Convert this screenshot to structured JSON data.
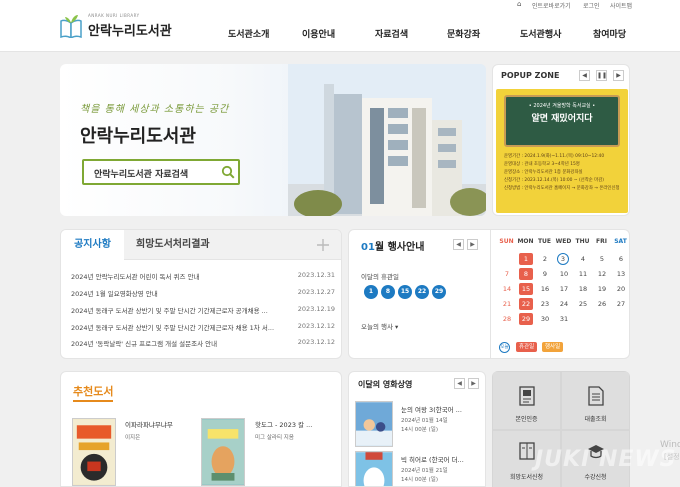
{
  "header": {
    "logo_sub": "ANRAK NURI LIBRARY",
    "logo_text": "안락누리도서관",
    "util": {
      "home": "⌂",
      "login_info": "인트로바로가기",
      "login": "로그인",
      "sitemap": "사이트맵"
    },
    "nav": [
      "도서관소개",
      "이용안내",
      "자료검색",
      "문화강좌",
      "도서관행사",
      "참여마당"
    ]
  },
  "hero": {
    "slogan": "책을 통해 세상과 소통하는 공간",
    "title": "안락누리도서관",
    "search_label": "안락누리도서관 자료검색"
  },
  "popup": {
    "title": "POPUP ZONE",
    "controls": [
      "◀",
      "❚❚",
      "▶"
    ],
    "poster_sub": "• 2024년 겨울방학 독서교실 •",
    "poster_main": "알면 재밌어지다",
    "poster_lines": [
      "운영기간 : 2024.1.9(화)~1.11.(목) 09:10~12:40",
      "운영대상 : 관내 초등학교 3~4학년 15명",
      "운영장소 : 안락누리도서관 1층 문화강좌실",
      "신청기간 : 2023.12.14.(목) 10:00 ~ (선착순 마감)",
      "신청방법 : 안락누리도서관 홈페이지 → 문화강좌 → 온라인신청"
    ]
  },
  "notice": {
    "tab_active": "공지사항",
    "tab_inactive": "희망도서처리결과",
    "rows": [
      {
        "title": "2024년 안락누리도서관 어린이 독서 퀴즈 안내",
        "date": "2023.12.31"
      },
      {
        "title": "2024년 1월 일요영화상영 안내",
        "date": "2023.12.27"
      },
      {
        "title": "2024년 동래구 도서관 상반기 및 주말 단시간 기간제근로자 공개채용 ...",
        "date": "2023.12.19"
      },
      {
        "title": "2024년 동래구 도서관 상반기 및 주말 단시간 기간제근로자 채용 1차 서...",
        "date": "2023.12.12"
      },
      {
        "title": "2024년 '동락날락' 신규 프로그램 개설 설문조사 안내",
        "date": "2023.12.12"
      }
    ]
  },
  "events": {
    "month": "01",
    "title_suffix": "월 행사안내",
    "closed_label": "이달의 휴관일",
    "closed_days": [
      "1",
      "8",
      "15",
      "22",
      "29"
    ],
    "today_label": "오늘의 행사",
    "dow": [
      "SUN",
      "MON",
      "TUE",
      "WED",
      "THU",
      "FRI",
      "SAT"
    ],
    "weeks": [
      [
        "",
        "1",
        "2",
        "3",
        "4",
        "5",
        "6"
      ],
      [
        "7",
        "8",
        "9",
        "10",
        "11",
        "12",
        "13"
      ],
      [
        "14",
        "15",
        "16",
        "17",
        "18",
        "19",
        "20"
      ],
      [
        "21",
        "22",
        "23",
        "24",
        "25",
        "26",
        "27"
      ],
      [
        "28",
        "29",
        "30",
        "31",
        "",
        "",
        ""
      ]
    ],
    "legend_today": "오늘",
    "legend_closed": "휴관일",
    "legend_event": "행사일",
    "colors": {
      "closed": "#e8604c",
      "event": "#f2a33a",
      "accent": "#1d7ac2"
    }
  },
  "recommend": {
    "title": "추천도서",
    "books": [
      {
        "title": "이파라파냐무냐무",
        "author": "이지은"
      },
      {
        "title": "핫도그 - 2023 칼 ...",
        "author": "미그 살라티 지음"
      }
    ]
  },
  "movies": {
    "title": "이달의 영화상영",
    "items": [
      {
        "title": "눈의 여왕 3(한국어 ...",
        "date": "2024년 01월 14일",
        "time": "14시 00분 (일)"
      },
      {
        "title": "빅 히어로 (한국어 더...",
        "date": "2024년 01월 21일",
        "time": "14시 00분 (일)"
      }
    ]
  },
  "services": [
    {
      "label": "본인인증",
      "icon": "id-card-icon"
    },
    {
      "label": "대출조회",
      "icon": "document-icon"
    },
    {
      "label": "희망도서신청",
      "icon": "book-request-icon"
    },
    {
      "label": "수강신청",
      "icon": "mortarboard-icon"
    }
  ],
  "overlay": {
    "windows_line1": "Windo",
    "windows_line2": "[설정]으",
    "brand": "JUKI NEWS"
  }
}
